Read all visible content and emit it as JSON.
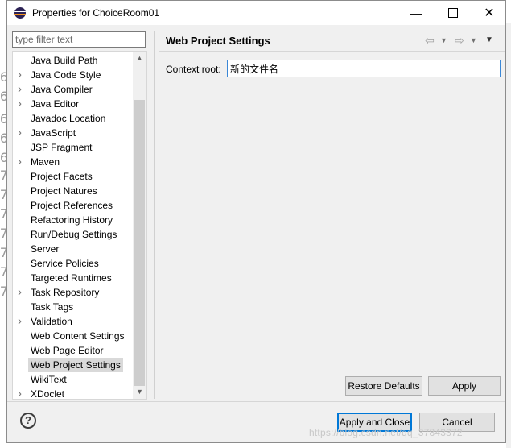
{
  "window": {
    "title": "Properties for ChoiceRoom01"
  },
  "filter": {
    "placeholder": "type filter text"
  },
  "tree": {
    "items": [
      {
        "label": "Java Build Path",
        "expandable": false
      },
      {
        "label": "Java Code Style",
        "expandable": true
      },
      {
        "label": "Java Compiler",
        "expandable": true
      },
      {
        "label": "Java Editor",
        "expandable": true
      },
      {
        "label": "Javadoc Location",
        "expandable": false
      },
      {
        "label": "JavaScript",
        "expandable": true
      },
      {
        "label": "JSP Fragment",
        "expandable": false
      },
      {
        "label": "Maven",
        "expandable": true
      },
      {
        "label": "Project Facets",
        "expandable": false
      },
      {
        "label": "Project Natures",
        "expandable": false
      },
      {
        "label": "Project References",
        "expandable": false
      },
      {
        "label": "Refactoring History",
        "expandable": false
      },
      {
        "label": "Run/Debug Settings",
        "expandable": false
      },
      {
        "label": "Server",
        "expandable": false
      },
      {
        "label": "Service Policies",
        "expandable": false
      },
      {
        "label": "Targeted Runtimes",
        "expandable": false
      },
      {
        "label": "Task Repository",
        "expandable": true
      },
      {
        "label": "Task Tags",
        "expandable": false
      },
      {
        "label": "Validation",
        "expandable": true
      },
      {
        "label": "Web Content Settings",
        "expandable": false
      },
      {
        "label": "Web Page Editor",
        "expandable": false
      },
      {
        "label": "Web Project Settings",
        "expandable": false,
        "selected": true
      },
      {
        "label": "WikiText",
        "expandable": false
      },
      {
        "label": "XDoclet",
        "expandable": true
      }
    ]
  },
  "page": {
    "title": "Web Project Settings",
    "context_root_label": "Context root:",
    "context_root_value": "新的文件名"
  },
  "buttons": {
    "restore_defaults": "Restore Defaults",
    "apply": "Apply",
    "apply_and_close": "Apply and Close",
    "cancel": "Cancel",
    "help": "?"
  },
  "watermark": "https://blog.csdn.net/qq_37843372",
  "colors": {
    "focus_border": "#0078d7",
    "selection": "#d9d9d9"
  }
}
